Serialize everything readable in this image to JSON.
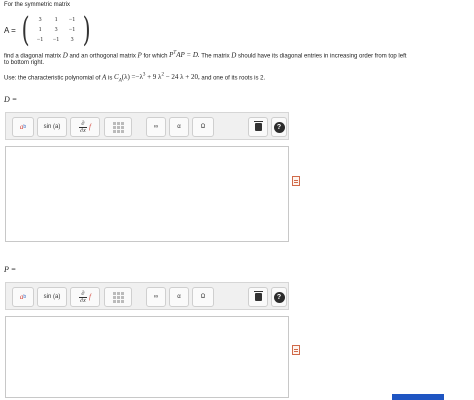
{
  "intro": "For the symmetric matrix",
  "matrix": {
    "label": "A =",
    "rows": [
      [
        "3",
        "1",
        "−1"
      ],
      [
        "1",
        "3",
        "−1"
      ],
      [
        "−1",
        "−1",
        "3"
      ]
    ]
  },
  "task": {
    "part1": "find a diagonal matrix",
    "D": "D",
    "part2": "and an orthogonal matrix",
    "P": "P",
    "part3": "for which",
    "eq_P": "P",
    "eq_T": "T",
    "eq_rest": "AP = D.",
    "part4": "The matrix",
    "part5": "should have its diagonal entries in increasing order from top left",
    "line2": "to bottom right."
  },
  "hint": {
    "prefix": "Use:  the characteristic polynomial of",
    "A": "A",
    "is": "is",
    "C": "C",
    "subA": "A",
    "poly1": "(λ) =−λ",
    "exp1": "3",
    "poly2": " + 9 λ",
    "exp2": "2",
    "poly3": " − 24 λ + 20,",
    "suffix": "and one of its roots is 2."
  },
  "answers": [
    {
      "label": "D ="
    },
    {
      "label": "P ="
    }
  ],
  "toolbar": {
    "power_base": "a",
    "power_exp": "b",
    "sin": "sin (a)",
    "deriv_num": "∂",
    "deriv_den": "∂x",
    "deriv_f": "f",
    "infinity": "∞",
    "alpha": "α",
    "omega": "Ω",
    "help": "?"
  },
  "colors": {
    "accent_blue": "#1f55c2",
    "toolbar_red": "#d4453a"
  }
}
